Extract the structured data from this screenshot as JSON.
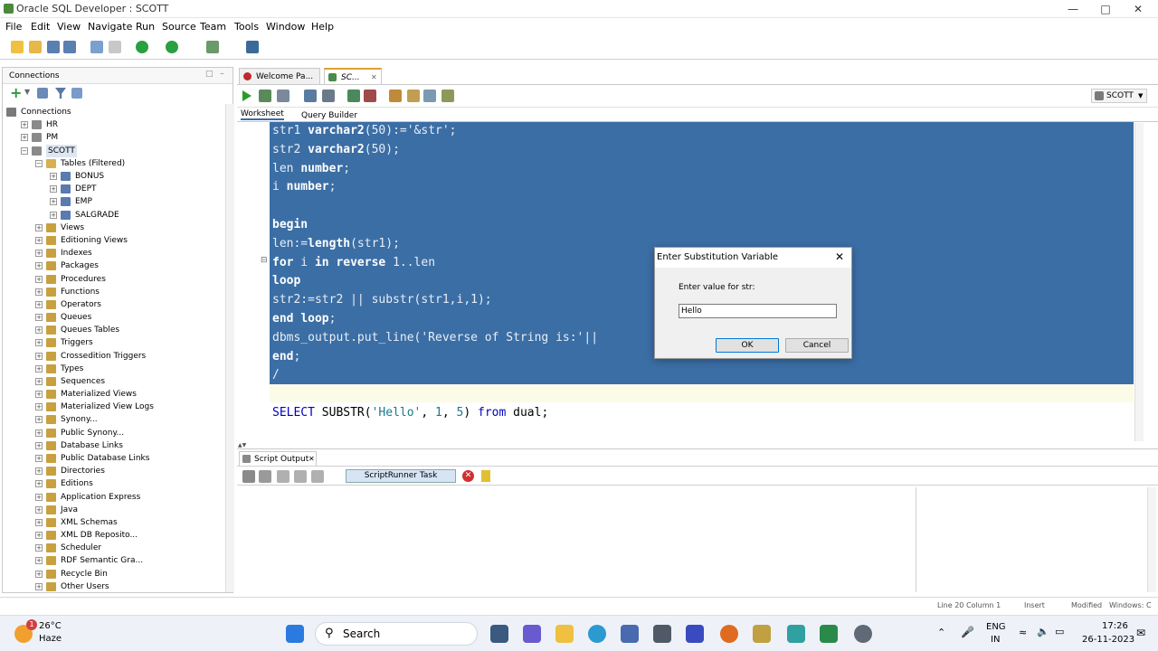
{
  "window": {
    "title": "Oracle SQL Developer : SCOTT"
  },
  "menu": [
    "File",
    "Edit",
    "View",
    "Navigate",
    "Run",
    "Source",
    "Team",
    "Tools",
    "Window",
    "Help"
  ],
  "connections_panel": {
    "title": "Connections",
    "root": "Connections",
    "connections": [
      "HR",
      "PM",
      "SCOTT"
    ],
    "tables_node": "Tables (Filtered)",
    "tables": [
      "BONUS",
      "DEPT",
      "EMP",
      "SALGRADE"
    ],
    "nodes": [
      "Views",
      "Editioning Views",
      "Indexes",
      "Packages",
      "Procedures",
      "Functions",
      "Operators",
      "Queues",
      "Queues Tables",
      "Triggers",
      "Crossedition Triggers",
      "Types",
      "Sequences",
      "Materialized Views",
      "Materialized View Logs",
      "Synony...",
      "Public Synony...",
      "Database Links",
      "Public Database Links",
      "Directories",
      "Editions",
      "Application Express",
      "Java",
      "XML Schemas",
      "XML DB Reposito...",
      "Scheduler",
      "RDF Semantic Gra...",
      "Recycle Bin",
      "Other Users"
    ]
  },
  "editor": {
    "tabs": [
      "Welcome Pa...",
      "SC..."
    ],
    "subtabs": [
      "Worksheet",
      "Query Builder"
    ],
    "connection_selector": "SCOTT",
    "selected_lines": [
      [
        [
          "str1 ",
          ""
        ],
        [
          "varchar2",
          "kw"
        ],
        [
          "(50):='&str';",
          ""
        ]
      ],
      [
        [
          "str2 ",
          ""
        ],
        [
          "varchar2",
          "kw"
        ],
        [
          "(50);",
          ""
        ]
      ],
      [
        [
          "len ",
          ""
        ],
        [
          "number",
          "kw"
        ],
        [
          ";",
          ""
        ]
      ],
      [
        [
          "i ",
          ""
        ],
        [
          "number",
          "kw"
        ],
        [
          ";",
          ""
        ]
      ],
      [
        [
          "",
          ""
        ]
      ],
      [
        [
          "begin",
          "kw"
        ]
      ],
      [
        [
          "len:=",
          ""
        ],
        [
          "length",
          "kw"
        ],
        [
          "(str1);",
          ""
        ]
      ],
      [
        [
          "for",
          "kw"
        ],
        [
          " i ",
          ""
        ],
        [
          "in",
          "kw"
        ],
        [
          " ",
          ""
        ],
        [
          "reverse",
          "kw"
        ],
        [
          " 1..len",
          ""
        ]
      ],
      [
        [
          "loop",
          "kw"
        ]
      ],
      [
        [
          "str2:=str2 || substr(str1,i,1);",
          ""
        ]
      ],
      [
        [
          "end",
          "kw"
        ],
        [
          " ",
          ""
        ],
        [
          "loop",
          "kw"
        ],
        [
          ";",
          ""
        ]
      ],
      [
        [
          "dbms_output.put_line('Reverse of String is:'||",
          ""
        ]
      ],
      [
        [
          "end",
          "kw"
        ],
        [
          ";",
          ""
        ]
      ],
      [
        [
          "/",
          ""
        ]
      ]
    ],
    "query_line": {
      "kw1": "SELECT",
      "fn": " SUBSTR(",
      "str": "'Hello'",
      "mid": ", ",
      "n1": "1",
      "comma": ", ",
      "n2": "5",
      "close": ") ",
      "kw2": "from",
      "tail": " dual;"
    }
  },
  "dialog": {
    "title": "Enter Substitution Variable",
    "label": "Enter value for str:",
    "value": "Hello",
    "ok": "OK",
    "cancel": "Cancel"
  },
  "output": {
    "tab": "Script Output",
    "task": "ScriptRunner Task"
  },
  "status": {
    "position": "Line 20 Column 1",
    "mode": "Insert",
    "modified": "Modified",
    "os": "Windows: C"
  },
  "taskbar": {
    "temp": "26°C",
    "weather": "Haze",
    "badge": "1",
    "search": "Search",
    "lang": "ENG",
    "region": "IN",
    "time": "17:26",
    "date": "26-11-2023"
  },
  "colors": {
    "selection": "#3b6ea5",
    "keyword_blue": "#0000c0",
    "string_teal": "#1a7a8c"
  }
}
